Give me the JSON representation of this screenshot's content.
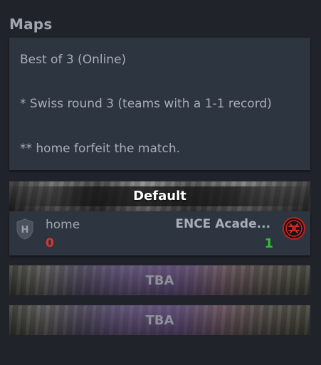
{
  "section": {
    "title": "Maps"
  },
  "info": {
    "line1": "Best of 3 (Online)",
    "line2": "* Swiss round 3 (teams with a 1-1 record)",
    "line3": "** home forfeit the match."
  },
  "maps": [
    {
      "name": "Default",
      "team_left": {
        "name": "home",
        "logo_letter": "H",
        "score": "0",
        "score_color": "#e0342d"
      },
      "team_right": {
        "name": "ENCE Acade...",
        "score": "1",
        "score_color": "#2fc22f",
        "logo_icon": "ence-logo-icon"
      }
    },
    {
      "name": "TBA"
    },
    {
      "name": "TBA"
    }
  ],
  "colors": {
    "background": "#20232a",
    "panel": "#2c3540",
    "loss": "#e0342d",
    "win": "#2fc22f"
  }
}
